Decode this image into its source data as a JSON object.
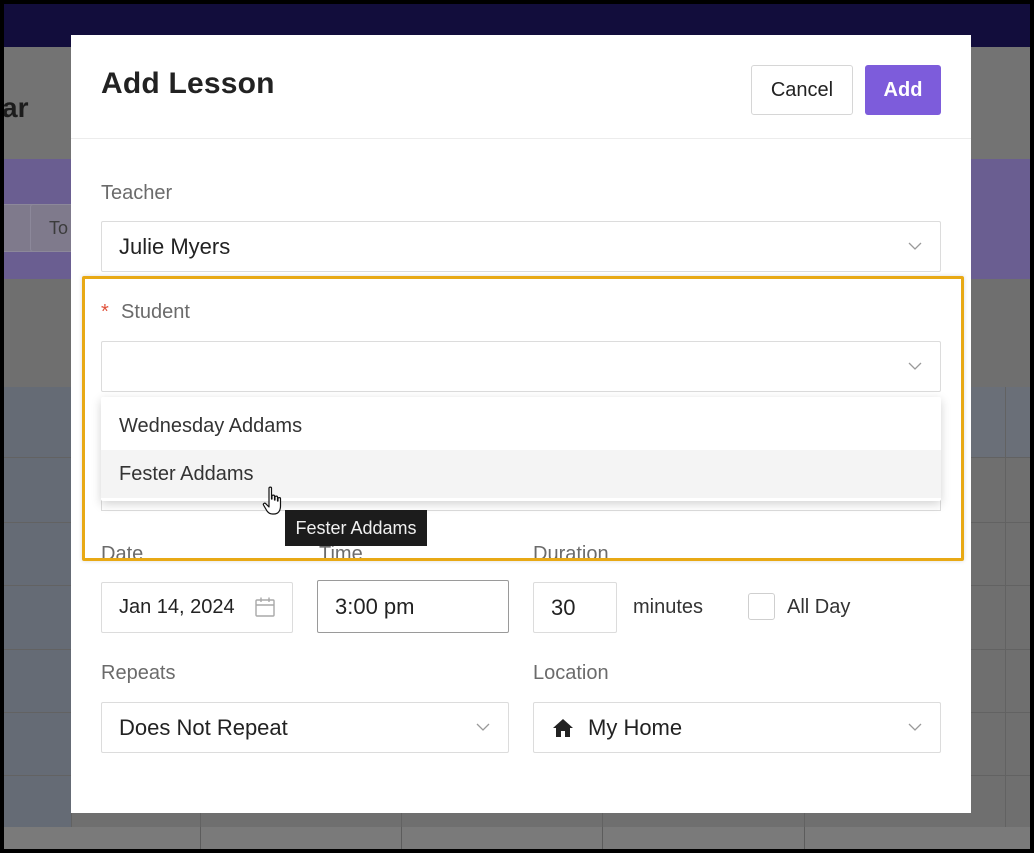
{
  "background": {
    "title_fragment": "ar",
    "band_buttons": [
      "",
      "To"
    ]
  },
  "modal": {
    "title": "Add Lesson",
    "cancel_label": "Cancel",
    "add_label": "Add",
    "teacher": {
      "label": "Teacher",
      "value": "Julie Myers"
    },
    "student": {
      "required_mark": "*",
      "label": "Student",
      "value": "",
      "options": [
        "Wednesday Addams",
        "Fester Addams"
      ],
      "hovered_option": "Fester Addams",
      "tooltip": "Fester Addams"
    },
    "date": {
      "label": "Date",
      "value": "Jan 14, 2024"
    },
    "time": {
      "label": "Time",
      "value": "3:00 pm"
    },
    "duration": {
      "label": "Duration",
      "value": "30",
      "unit": "minutes"
    },
    "all_day": {
      "label": "All Day",
      "checked": false
    },
    "repeats": {
      "label": "Repeats",
      "value": "Does Not Repeat"
    },
    "location": {
      "label": "Location",
      "value": "My Home",
      "icon": "home-icon"
    }
  },
  "colors": {
    "accent": "#7d5cdb",
    "highlight": "#e8a915",
    "required": "#e0513a"
  }
}
